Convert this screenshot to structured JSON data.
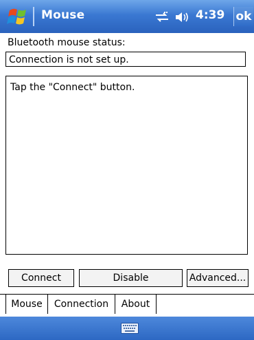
{
  "titlebar": {
    "app_title": "Mouse",
    "clock": "4:39",
    "ok_label": "ok",
    "start_icon": "windows-flag-icon",
    "sync_icon": "connectivity-icon",
    "volume_icon": "speaker-icon"
  },
  "content": {
    "status_label": "Bluetooth mouse status:",
    "status_value": "Connection is not set up.",
    "log_text": "Tap the \"Connect\" button."
  },
  "buttons": {
    "connect": "Connect",
    "disable": "Disable",
    "advanced": "Advanced..."
  },
  "tabs": [
    {
      "label": "Mouse"
    },
    {
      "label": "Connection",
      "selected": true
    },
    {
      "label": "About"
    }
  ],
  "bottom_bar": {
    "keyboard_icon": "keyboard-icon"
  },
  "colors": {
    "titlebar": "#3a78d2",
    "bottom_bar": "#2d68c3"
  }
}
